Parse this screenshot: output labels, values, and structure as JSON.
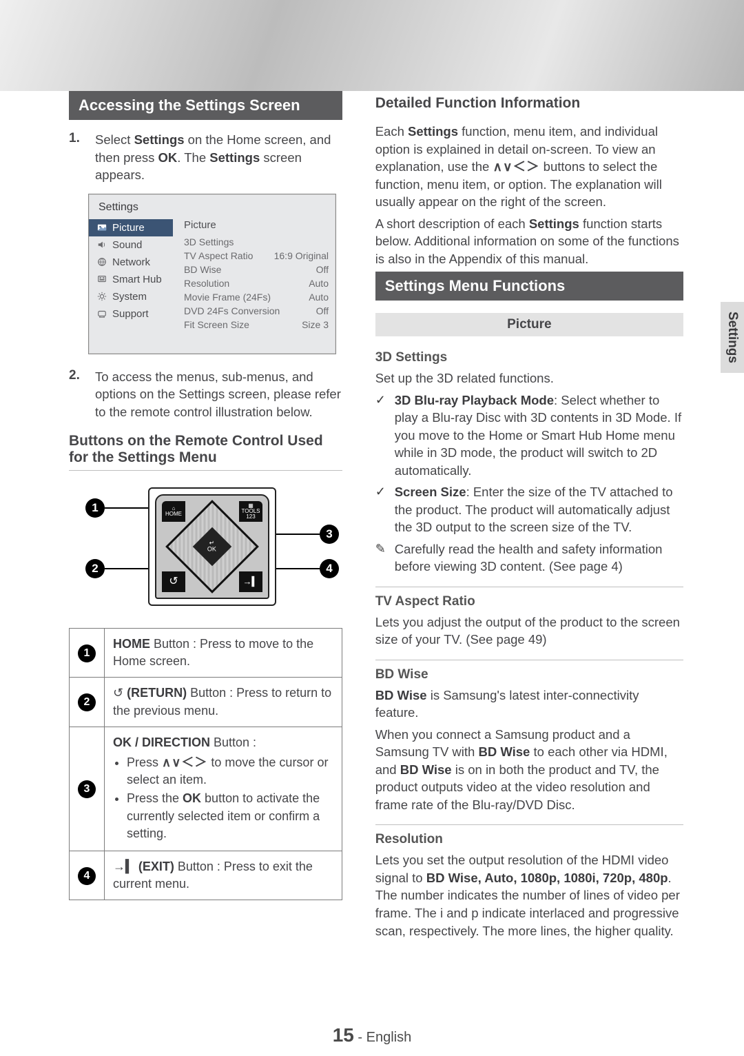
{
  "side_tab": "Settings",
  "footer": {
    "page": "15",
    "sep": " - ",
    "lang": "English"
  },
  "left": {
    "h1": "Accessing the Settings Screen",
    "step1_pre": "Select ",
    "step1_b1": "Settings",
    "step1_mid": " on the Home screen, and then press ",
    "step1_b2": "OK",
    "step1_post1": ". The ",
    "step1_b3": "Settings",
    "step1_post2": " screen appears.",
    "settings_mock": {
      "title": "Settings",
      "panel_title": "Picture",
      "sidebar": [
        {
          "label": "Picture",
          "active": true
        },
        {
          "label": "Sound"
        },
        {
          "label": "Network"
        },
        {
          "label": "Smart Hub"
        },
        {
          "label": "System"
        },
        {
          "label": "Support"
        }
      ],
      "rows": [
        {
          "k": "3D Settings",
          "v": ""
        },
        {
          "k": "TV Aspect Ratio",
          "v": "16:9 Original"
        },
        {
          "k": "BD Wise",
          "v": "Off"
        },
        {
          "k": "Resolution",
          "v": "Auto"
        },
        {
          "k": "Movie Frame (24Fs)",
          "v": "Auto"
        },
        {
          "k": "DVD 24Fs Conversion",
          "v": "Off"
        },
        {
          "k": "Fit Screen Size",
          "v": "Size 3"
        }
      ]
    },
    "step2": "To access the menus, sub-menus, and options on the Settings screen, please refer to the remote control illustration below.",
    "remote_heading": "Buttons on the Remote Control Used for the Settings Menu",
    "remote_labels": {
      "home": "HOME",
      "tools": "TOOLS",
      "tools_sub": "123",
      "ok_top": "↵",
      "ok": "OK",
      "return_glyph": "↺",
      "exit_glyph": "→▍"
    },
    "legend": {
      "r1_b": "HOME",
      "r1_rest": " Button : Press to move to the Home screen.",
      "r2_glyph": "↺",
      "r2_b": " (RETURN)",
      "r2_rest": " Button : Press to return to the previous menu.",
      "r3_b": "OK / DIRECTION",
      "r3_rest": " Button :",
      "r3_li1_pre": "Press ",
      "r3_li1_keys": "∧∨＜＞",
      "r3_li1_post": " to move the cursor or select an item.",
      "r3_li2_pre": "Press the ",
      "r3_li2_b": "OK",
      "r3_li2_post": " button to activate the currently selected item or confirm a setting.",
      "r4_glyph": "→▍",
      "r4_b": " (EXIT)",
      "r4_rest": " Button : Press to exit the current menu."
    }
  },
  "right": {
    "dfi_heading": "Detailed Function Information",
    "dfi_p1_pre": "Each ",
    "dfi_p1_b1": "Settings",
    "dfi_p1_mid": " function, menu item, and individual option is explained in detail on-screen. To view an explanation, use the ",
    "dfi_p1_keys": "∧∨＜＞",
    "dfi_p1_post": " buttons to select the function, menu item, or option. The explanation will usually appear on the right of the screen.",
    "dfi_p2_pre": "A short description of each ",
    "dfi_p2_b1": "Settings",
    "dfi_p2_post": " function starts below. Additional information on some of the functions is also in the Appendix of this manual.",
    "h2": "Settings Menu Functions",
    "cat_picture": "Picture",
    "sec1_title": "3D Settings",
    "sec1_lead": "Set up the 3D related functions.",
    "sec1_li1_b": "3D Blu-ray Playback Mode",
    "sec1_li1_rest": ": Select whether to play a Blu-ray Disc with 3D contents in 3D Mode. If you move to the Home or Smart Hub Home menu while in 3D mode, the product will switch to 2D automatically.",
    "sec1_li2_b": "Screen Size",
    "sec1_li2_rest": ": Enter the size of the TV attached to the product. The product will automatically adjust the 3D output to the screen size of the TV.",
    "sec1_note": "Carefully read the health and safety information before viewing 3D content. (See page 4)",
    "sec2_title": "TV Aspect Ratio",
    "sec2_body": "Lets you adjust the output of the product to the screen size of your TV. (See page 49)",
    "sec3_title": "BD Wise",
    "sec3_p1_b1": "BD Wise",
    "sec3_p1_rest": " is Samsung's latest inter-connectivity feature.",
    "sec3_p2_pre": "When you connect a Samsung product and a Samsung TV with ",
    "sec3_p2_b1": "BD Wise",
    "sec3_p2_mid": " to each other via HDMI, and ",
    "sec3_p2_b2": "BD Wise",
    "sec3_p2_post": " is on in both the product and TV, the product outputs video at the video resolution and frame rate of the Blu-ray/DVD Disc.",
    "sec4_title": "Resolution",
    "sec4_pre": "Lets you set the output resolution of the HDMI video signal to ",
    "sec4_b": "BD Wise, Auto, 1080p, 1080i, 720p, 480p",
    "sec4_post": ". The number indicates the number of lines of video per frame. The i and p indicate interlaced and progressive scan, respectively. The more lines, the higher quality."
  }
}
